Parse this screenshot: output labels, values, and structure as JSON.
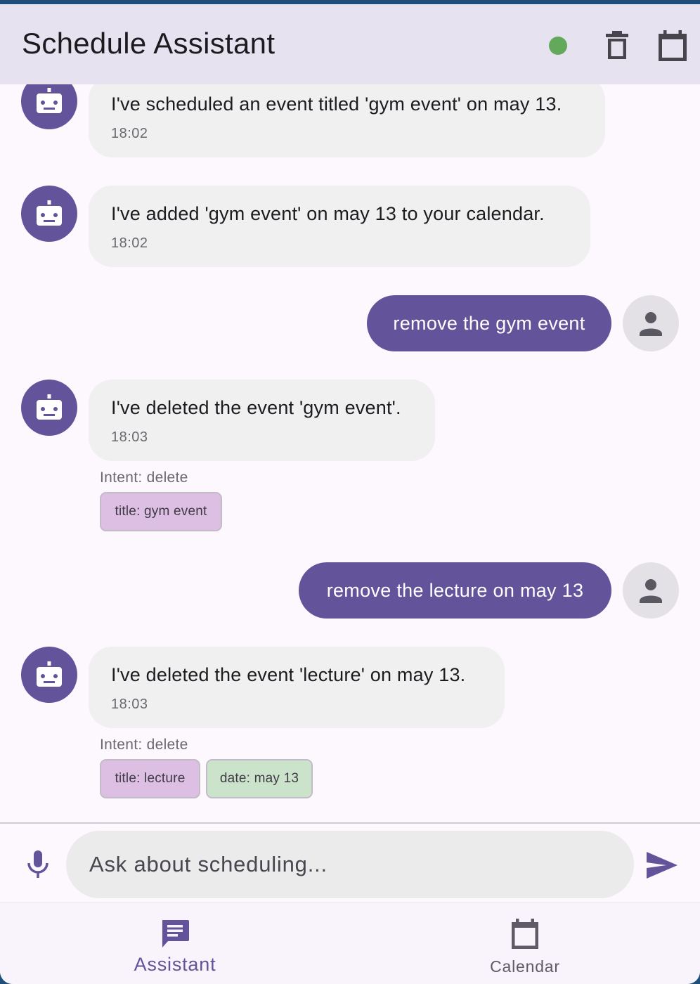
{
  "app": {
    "title": "Schedule Assistant",
    "accent_color": "#62539b",
    "status_color": "#63a95c",
    "status_icon": "online-status-dot",
    "actions": [
      {
        "icon": "trash-icon",
        "label": "Clear chat"
      },
      {
        "icon": "calendar-icon",
        "label": "Open calendar"
      }
    ]
  },
  "messages": [
    {
      "sender": "bot",
      "icon": "robot-icon",
      "text": "I've scheduled an event titled 'gym event' on may 13.",
      "time": "18:02"
    },
    {
      "sender": "bot",
      "icon": "robot-icon",
      "text": "I've added 'gym event'  on may 13 to your calendar.",
      "time": "18:02"
    },
    {
      "sender": "user",
      "icon": "person-icon",
      "text": "remove the gym event"
    },
    {
      "sender": "bot",
      "icon": "robot-icon",
      "text": "I've deleted the event 'gym event'.",
      "time": "18:03",
      "intent": "Intent: delete",
      "entities": [
        "title: gym event"
      ]
    },
    {
      "sender": "user",
      "icon": "person-icon",
      "text": "remove the lecture on may 13"
    },
    {
      "sender": "bot",
      "icon": "robot-icon",
      "text": "I've deleted the event 'lecture' on may 13.",
      "time": "18:03",
      "intent": "Intent: delete",
      "entities": [
        "title: lecture",
        "date: may 13"
      ]
    }
  ],
  "input": {
    "placeholder": "Ask about scheduling...",
    "value": "",
    "mic_icon": "microphone-icon",
    "send_icon": "send-icon"
  },
  "nav": {
    "items": [
      {
        "label": "Assistant",
        "icon": "chat-icon",
        "active": true
      },
      {
        "label": "Calendar",
        "icon": "calendar-icon",
        "active": false
      }
    ],
    "active_color": "#62539b",
    "inactive_color": "#5f5b66"
  }
}
